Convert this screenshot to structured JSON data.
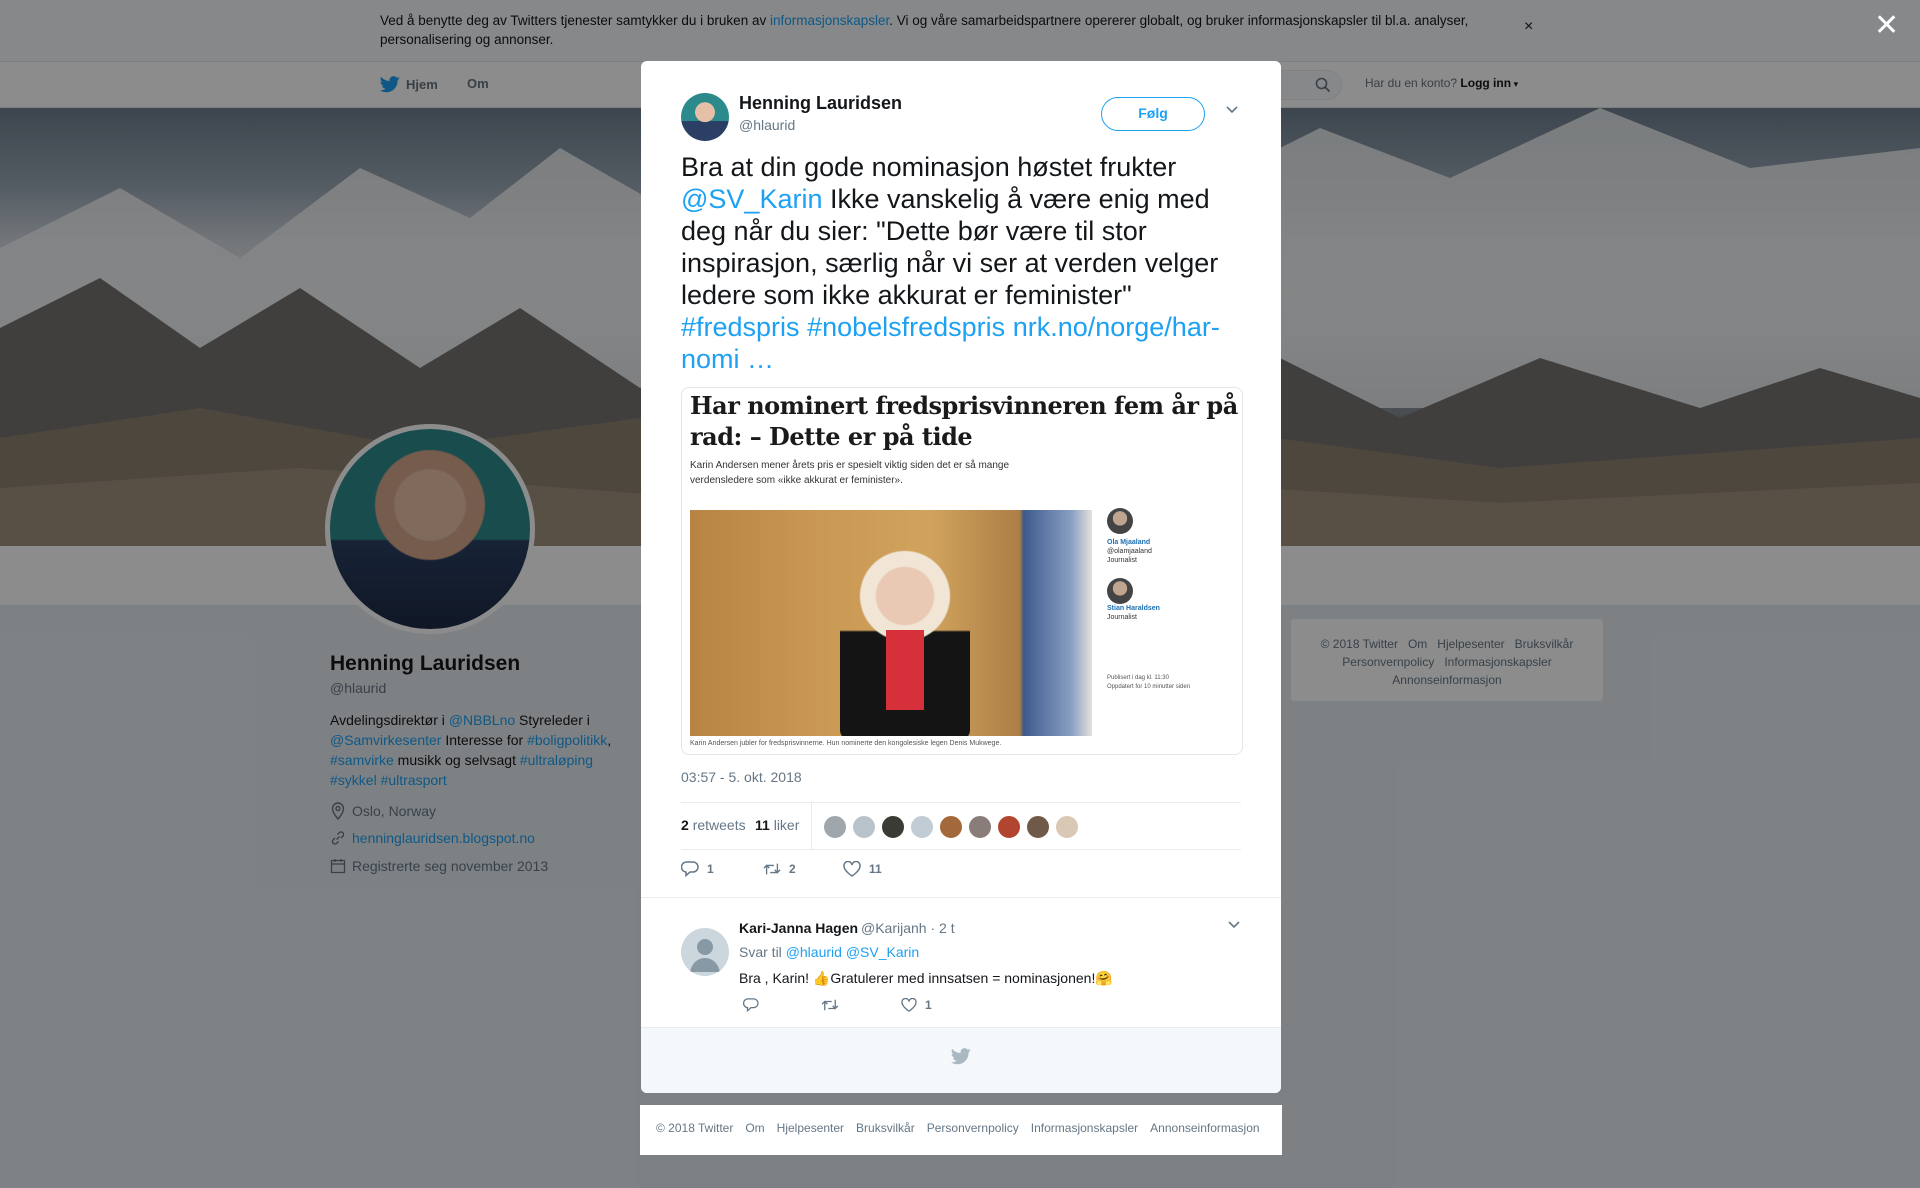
{
  "cookie": {
    "text_before": "Ved å benytte deg av Twitters tjenester samtykker du i bruken av ",
    "link": "informasjonskapsler",
    "text_after": ". Vi og våre samarbeidspartnere opererer globalt, og bruker informasjonskapsler til bl.a. analyser, personalisering og annonser.",
    "close": "×"
  },
  "nav": {
    "home": "Hjem",
    "about": "Om",
    "login_prompt": "Har du en konto?",
    "login": "Logg inn"
  },
  "profile": {
    "name": "Henning Lauridsen",
    "handle": "@hlaurid",
    "bio_1": "Avdelingsdirektør i ",
    "bio_link_1": "@NBBLno",
    "bio_2": " Styreleder i ",
    "bio_link_2": "@Samvirkesenter",
    "bio_3": " Interesse for ",
    "bio_link_3": "#boligpolitikk",
    "bio_4": ", ",
    "bio_link_4": "#samvirke",
    "bio_5": " musikk og selvsagt ",
    "bio_link_5": "#ultraløping",
    "bio_link_6": "#sykkel",
    "bio_link_7": "#ultrasport",
    "location": "Oslo, Norway",
    "website": "henninglauridsen.blogspot.no",
    "joined": "Registrerte seg november 2013"
  },
  "side_footer": {
    "items_1": [
      "© 2018 Twitter",
      "Om",
      "Hjelpesenter",
      "Bruksvilkår"
    ],
    "items_2": [
      "Personvernpolicy",
      "Informasjonskapsler"
    ],
    "items_3": [
      "Annonseinformasjon"
    ]
  },
  "overlay": {
    "close": "✕"
  },
  "tweet": {
    "name": "Henning Lauridsen",
    "handle": "@hlaurid",
    "follow": "Følg",
    "text_1": "Bra at din gode nominasjon høstet frukter ",
    "mention": "@SV_Karin",
    "text_2": " Ikke vanskelig å være enig med deg når du sier: \"Dette bør være til stor inspirasjon, særlig når vi ser at verden velger ledere som ikke akkurat er feminister\" ",
    "hashtag_1": "#fredspris",
    "hashtag_2": "#nobelsfredspris",
    "url": "nrk.no/norge/har-nomi",
    "ellipsis": "…",
    "media": {
      "headline": "Har nominert fredsprisvinneren fem år på rad: – Dette er på tide",
      "lede": "Karin Andersen mener årets pris er spesielt viktig siden det er så mange verdensledere som «ikke akkurat er feminister».",
      "caption": "Karin Andersen jubler for fredsprisvinnerne. Hun nominerte den kongolesiske legen Denis Mukwege.",
      "author_1_name": "Ola Mjaaland",
      "author_1_handle": "@olamjaaland",
      "author_1_role": "Journalist",
      "author_2_name": "Stian Haraldsen",
      "author_2_role": "Journalist",
      "published": "Publisert i dag kl. 11:30",
      "updated": "Oppdatert for 10 minutter siden"
    },
    "time": "03:57 - 5. okt. 2018",
    "retweets_count": "2",
    "retweets_label": "retweets",
    "likes_count": "11",
    "likes_label": "liker",
    "reply_count": "1",
    "retweet_action_count": "2",
    "like_action_count": "11"
  },
  "reply": {
    "name": "Kari-Janna Hagen",
    "handle": "@Karijanh · 2 t",
    "reply_to_label": "Svar til ",
    "reply_to_mentions": "@hlaurid @SV_Karin",
    "text": "Bra , Karin! 👍Gratulerer med innsatsen  = nominasjonen!🤗",
    "like_count": "1"
  },
  "bottom_footer": {
    "items": [
      "© 2018 Twitter",
      "Om",
      "Hjelpesenter",
      "Bruksvilkår",
      "Personvernpolicy",
      "Informasjonskapsler",
      "Annonseinformasjon"
    ]
  },
  "colors": {
    "accent": "#1da1f2",
    "text": "#14171a",
    "muted": "#657786"
  }
}
